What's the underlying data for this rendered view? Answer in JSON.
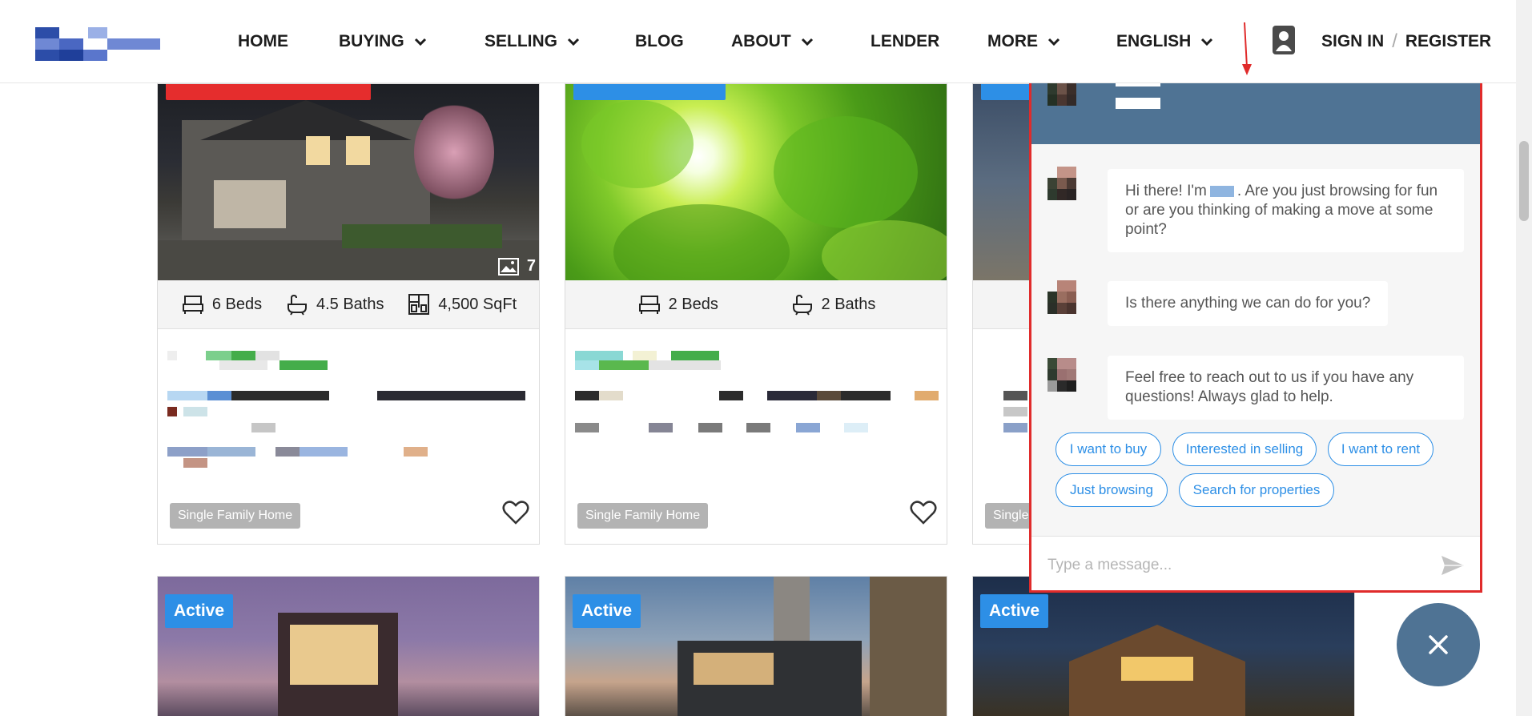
{
  "header": {
    "nav": [
      {
        "label": "HOME",
        "dropdown": false
      },
      {
        "label": "BUYING",
        "dropdown": true
      },
      {
        "label": "SELLING",
        "dropdown": true
      },
      {
        "label": "BLOG",
        "dropdown": false
      },
      {
        "label": "ABOUT",
        "dropdown": true
      },
      {
        "label": "LENDER",
        "dropdown": false
      },
      {
        "label": "MORE",
        "dropdown": true
      },
      {
        "label": "ENGLISH",
        "dropdown": true
      }
    ],
    "sign_in": "SIGN IN",
    "separator": "/",
    "register": "REGISTER"
  },
  "listings": [
    {
      "beds": "6 Beds",
      "baths": "4.5 Baths",
      "sqft": "4,500 SqFt",
      "photo_count": "7",
      "type": "Single Family Home"
    },
    {
      "beds": "2 Beds",
      "baths": "2 Baths",
      "type": "Single Family Home"
    },
    {
      "type": "Single"
    }
  ],
  "second_row": [
    {
      "status": "Active"
    },
    {
      "status": "Active"
    },
    {
      "status": "Active"
    }
  ],
  "chat": {
    "messages": [
      {
        "text_before": "Hi there! I'm",
        "text_after": ". Are you just browsing for fun or are you thinking of making a move at some point?"
      },
      {
        "text": "Is there anything we can do for you?"
      },
      {
        "text": "Feel free to reach out to us if you have any questions! Always glad to help."
      }
    ],
    "quick_replies": [
      "I want to buy",
      "Interested in selling",
      "I want to rent",
      "Just browsing",
      "Search for properties"
    ],
    "input_placeholder": "Type a message...",
    "close_label": "×"
  },
  "colors": {
    "accent_blue": "#2d8fe6",
    "chat_header": "#4f7394",
    "highlight_red": "#e02b2b",
    "badge_gray": "#b3b3b3"
  },
  "icons": [
    "bed-icon",
    "bath-icon",
    "sqft-icon",
    "image-icon",
    "heart-icon",
    "user-icon",
    "chevron-down-icon",
    "send-icon",
    "close-icon"
  ]
}
